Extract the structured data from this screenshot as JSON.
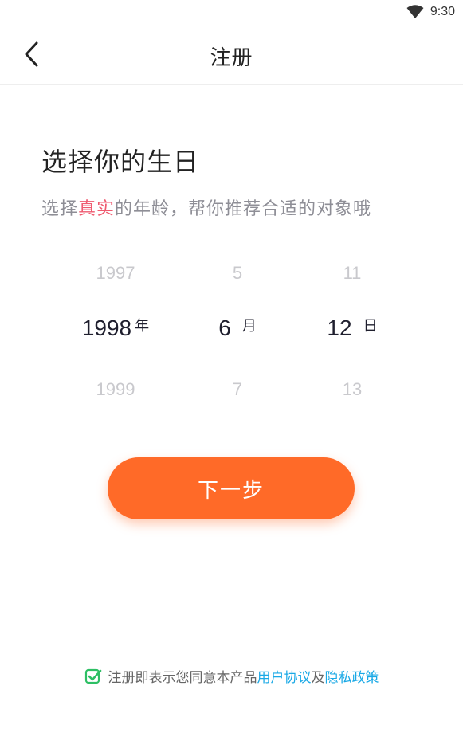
{
  "status_bar": {
    "time": "9:30"
  },
  "nav": {
    "title": "注册"
  },
  "main": {
    "heading": "选择你的生日",
    "subheading_pre": "选择",
    "subheading_highlight": "真实",
    "subheading_post": "的年龄，帮你推荐合适的对象哦"
  },
  "picker": {
    "year": {
      "prev": "1997",
      "selected": "1998",
      "next": "1999",
      "unit": "年"
    },
    "month": {
      "prev": "5",
      "selected": "6",
      "next": "7",
      "unit": "月"
    },
    "day": {
      "prev": "11",
      "selected": "12",
      "next": "13",
      "unit": "日"
    }
  },
  "actions": {
    "next_label": "下一步"
  },
  "agreement": {
    "checked": true,
    "text": "注册即表示您同意本产品",
    "link1": "用户协议",
    "conj": "及",
    "link2": "隐私政策"
  },
  "colors": {
    "accent": "#ff6a28",
    "highlight": "#ef5a6f",
    "link": "#1aa9e6",
    "check": "#2dbf64"
  }
}
